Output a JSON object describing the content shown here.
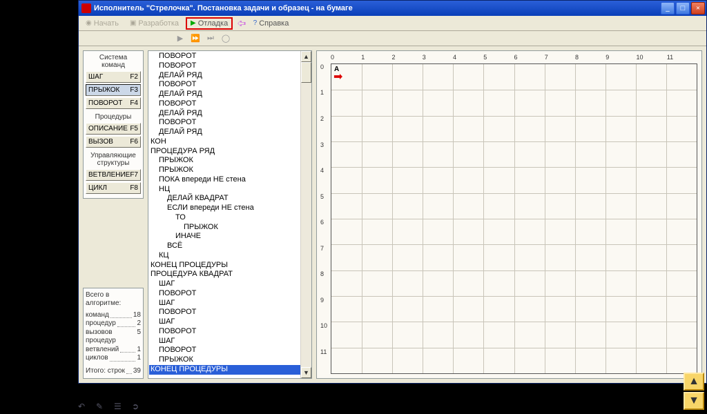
{
  "title": "Исполнитель \"Стрелочка\". Постановка задачи и образец - на бумаге",
  "menu": {
    "m1": "Начать",
    "m2": "Разработка",
    "m3": "Отладка",
    "m4": "Справка"
  },
  "sidebar": {
    "sec1": "Система\nкоманд",
    "btn_shag": "ШАГ",
    "key_shag": "F2",
    "btn_pry": "ПРЫЖОК",
    "key_pry": "F3",
    "btn_pov": "ПОВОРОТ",
    "key_pov": "F4",
    "sec2": "Процедуры",
    "btn_opis": "ОПИСАНИЕ",
    "key_opis": "F5",
    "btn_vyz": "ВЫЗОВ",
    "key_vyz": "F6",
    "sec3": "Управляющие\nструктуры",
    "btn_vet": "ВЕТВЛЕНИЕ",
    "key_vet": "F7",
    "btn_cyc": "ЦИКЛ",
    "key_cyc": "F8"
  },
  "stats": {
    "header": "Всего в алгоритме:",
    "l1": "команд",
    "v1": "18",
    "l2": "процедур",
    "v2": "2",
    "l3": "вызовов процедур",
    "v3": "5",
    "l4": "ветвлений",
    "v4": "1",
    "l5": "циклов",
    "v5": "1",
    "l6": "Итого:  строк",
    "v6": "39"
  },
  "code": [
    {
      "t": "ПОВОРОТ",
      "i": 1
    },
    {
      "t": "ПОВОРОТ",
      "i": 1
    },
    {
      "t": "ДЕЛАЙ РЯД",
      "i": 1
    },
    {
      "t": "ПОВОРОТ",
      "i": 1
    },
    {
      "t": "ДЕЛАЙ РЯД",
      "i": 1
    },
    {
      "t": "ПОВОРОТ",
      "i": 1
    },
    {
      "t": "ДЕЛАЙ РЯД",
      "i": 1
    },
    {
      "t": "ПОВОРОТ",
      "i": 1
    },
    {
      "t": "ДЕЛАЙ РЯД",
      "i": 1
    },
    {
      "t": "КОН",
      "i": 0
    },
    {
      "t": "ПРОЦЕДУРА РЯД",
      "i": 0
    },
    {
      "t": "ПРЫЖОК",
      "i": 1
    },
    {
      "t": "ПРЫЖОК",
      "i": 1
    },
    {
      "t": "ПОКА впереди НЕ стена",
      "i": 1
    },
    {
      "t": "НЦ",
      "i": 1
    },
    {
      "t": "ДЕЛАЙ КВАДРАТ",
      "i": 2
    },
    {
      "t": "ЕСЛИ впереди НЕ стена",
      "i": 2
    },
    {
      "t": "ТО",
      "i": 3
    },
    {
      "t": "ПРЫЖОК",
      "i": 4
    },
    {
      "t": "ИНАЧЕ",
      "i": 3
    },
    {
      "t": "ВСЁ",
      "i": 2
    },
    {
      "t": "КЦ",
      "i": 1
    },
    {
      "t": "КОНЕЦ ПРОЦЕДУРЫ",
      "i": 0
    },
    {
      "t": "ПРОЦЕДУРА КВАДРАТ",
      "i": 0
    },
    {
      "t": "ШАГ",
      "i": 1
    },
    {
      "t": "ПОВОРОТ",
      "i": 1
    },
    {
      "t": "ШАГ",
      "i": 1
    },
    {
      "t": "ПОВОРОТ",
      "i": 1
    },
    {
      "t": "ШАГ",
      "i": 1
    },
    {
      "t": "ПОВОРОТ",
      "i": 1
    },
    {
      "t": "ШАГ",
      "i": 1
    },
    {
      "t": "ПОВОРОТ",
      "i": 1
    },
    {
      "t": "ПРЫЖОК",
      "i": 1
    },
    {
      "t": "КОНЕЦ ПРОЦЕДУРЫ",
      "i": 0,
      "sel": true
    }
  ],
  "grid": {
    "cols": 12,
    "rows": 12,
    "robot_label": "A"
  },
  "axis_x": [
    "0",
    "1",
    "2",
    "3",
    "4",
    "5",
    "6",
    "7",
    "8",
    "9",
    "10",
    "11"
  ],
  "axis_y": [
    "0",
    "1",
    "2",
    "3",
    "4",
    "5",
    "6",
    "7",
    "8",
    "9",
    "10",
    "11"
  ]
}
